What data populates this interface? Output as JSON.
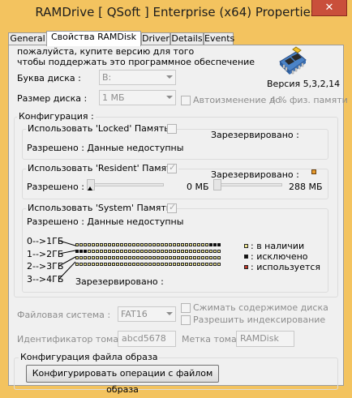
{
  "window": {
    "title": "RAMDrive [ QSoft ] Enterprise (x64) Properties",
    "close_glyph": "✕"
  },
  "tabs": [
    {
      "label": "General",
      "active": false
    },
    {
      "label": "Свойства RAMDisk",
      "active": true
    },
    {
      "label": "Driver",
      "active": false
    },
    {
      "label": "Details",
      "active": false
    },
    {
      "label": "Events",
      "active": false
    }
  ],
  "notice": {
    "line1": "пожалуйста, купите версию для того",
    "line2": "чтобы поддержать это программное обеспечение"
  },
  "version": "Версия 5,3,2,14",
  "drive_letter": {
    "label": "Буква диска :",
    "value": "B:"
  },
  "disk_size": {
    "label": "Размер диска :",
    "value": "1 МБ"
  },
  "auto_resize": {
    "label": "Автоизменение до",
    "percent": "4",
    "suffix": "% физ. памяти",
    "checked": false
  },
  "config": {
    "label": "Конфигурация :",
    "locked": {
      "label": "Использовать 'Locked' Память",
      "checked": false,
      "reserved_label": "Зарезервировано :",
      "allowed": "Разрешено : Данные недоступны"
    },
    "resident": {
      "label": "Использовать 'Resident' Память",
      "checked": true,
      "reserved_label": "Зарезервировано :",
      "allowed_label": "Разрешено :",
      "reserved_value": "0 МБ",
      "max_value": "288 МБ",
      "slider_fraction": 0.0
    },
    "system": {
      "label": "Использовать 'System' Память",
      "checked": true,
      "allowed": "Разрешено : Данные недоступны",
      "ranges": [
        "0-->1ГБ",
        "1-->2ГБ",
        "2-->3ГБ",
        "3-->4ГБ"
      ],
      "reserved_label": "Зарезервировано :",
      "legend": [
        {
          "label": ": в наличии",
          "color": "#f2ea93"
        },
        {
          "label": ": исключено",
          "color": "#111111"
        },
        {
          "label": ": используется",
          "color": "#c0392b"
        }
      ]
    }
  },
  "filesystem": {
    "label": "Файловая система :",
    "value": "FAT16"
  },
  "compress": {
    "label": "Сжимать содержимое диска",
    "checked": false
  },
  "indexing": {
    "label": "Разрешить индексирование",
    "checked": false
  },
  "volume_id": {
    "label": "Идентификатор тома :",
    "value": "abcd5678"
  },
  "volume_label": {
    "label": "Метка тома :",
    "value": "RAMDisk"
  },
  "image_config": {
    "label": "Конфигурация файла образа",
    "button": "Конфигурировать операции с файлом образа"
  }
}
